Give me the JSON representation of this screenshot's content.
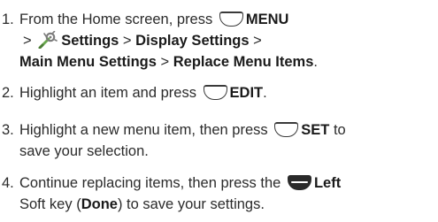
{
  "steps": [
    {
      "number": "1.",
      "parts": {
        "a": "From the Home screen, press",
        "menu": "MENU",
        "sep1": ">",
        "settings": "Settings",
        "sep2": ">",
        "display": "Display Settings",
        "sep3": ">",
        "main_menu": "Main Menu Settings",
        "sep4": ">",
        "replace": "Replace Menu Items",
        "end": "."
      }
    },
    {
      "number": "2.",
      "parts": {
        "a": "Highlight an item and press",
        "edit": "EDIT",
        "end": "."
      }
    },
    {
      "number": "3.",
      "parts": {
        "a": "Highlight a new menu item, then press",
        "set": "SET",
        "b": "to",
        "c": "save your selection."
      }
    },
    {
      "number": "4.",
      "parts": {
        "a": "Continue replacing items, then press the",
        "left": "Left",
        "b": "Soft key (",
        "done": "Done",
        "c": ") to save your settings."
      }
    }
  ],
  "icons": {
    "center_key": "center-softkey-icon",
    "left_key": "left-softkey-icon",
    "settings": "settings-icon"
  }
}
